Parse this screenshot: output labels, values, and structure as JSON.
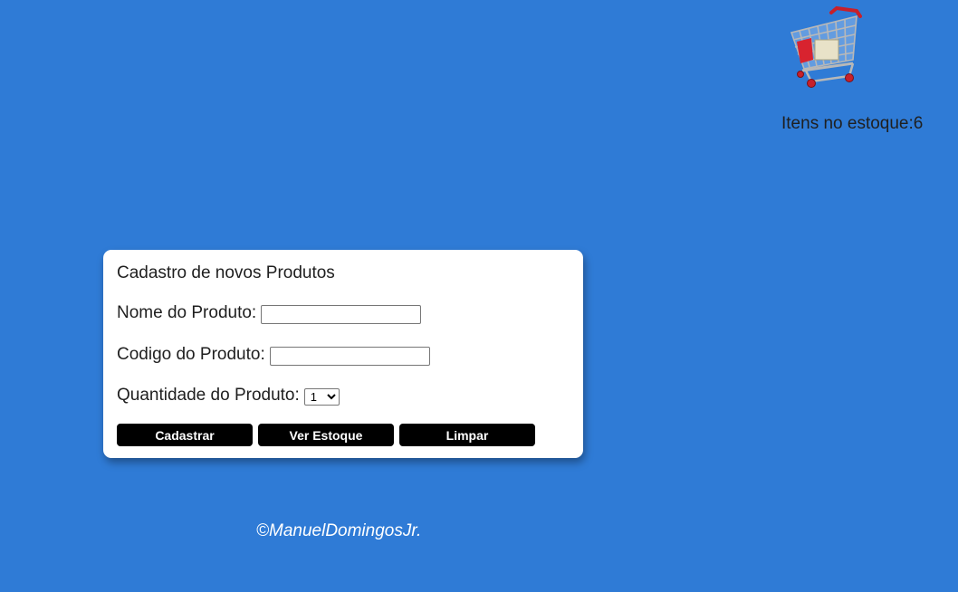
{
  "header": {
    "cart_icon": "shopping-cart-icon",
    "stock_label": "Itens no estoque:6"
  },
  "form": {
    "title": "Cadastro de novos Produtos",
    "name_label": "Nome do Produto:",
    "name_value": "",
    "code_label": "Codigo do Produto:",
    "code_value": "",
    "qty_label": "Quantidade do Produto:",
    "qty_selected": "1",
    "buttons": {
      "register": "Cadastrar",
      "view_stock": "Ver Estoque",
      "clear": "Limpar"
    }
  },
  "footer": {
    "credit": "©ManuelDomingosJr."
  },
  "colors": {
    "background": "#2f7bd6",
    "card": "#ffffff",
    "button": "#000000",
    "button_text": "#ffffff"
  }
}
